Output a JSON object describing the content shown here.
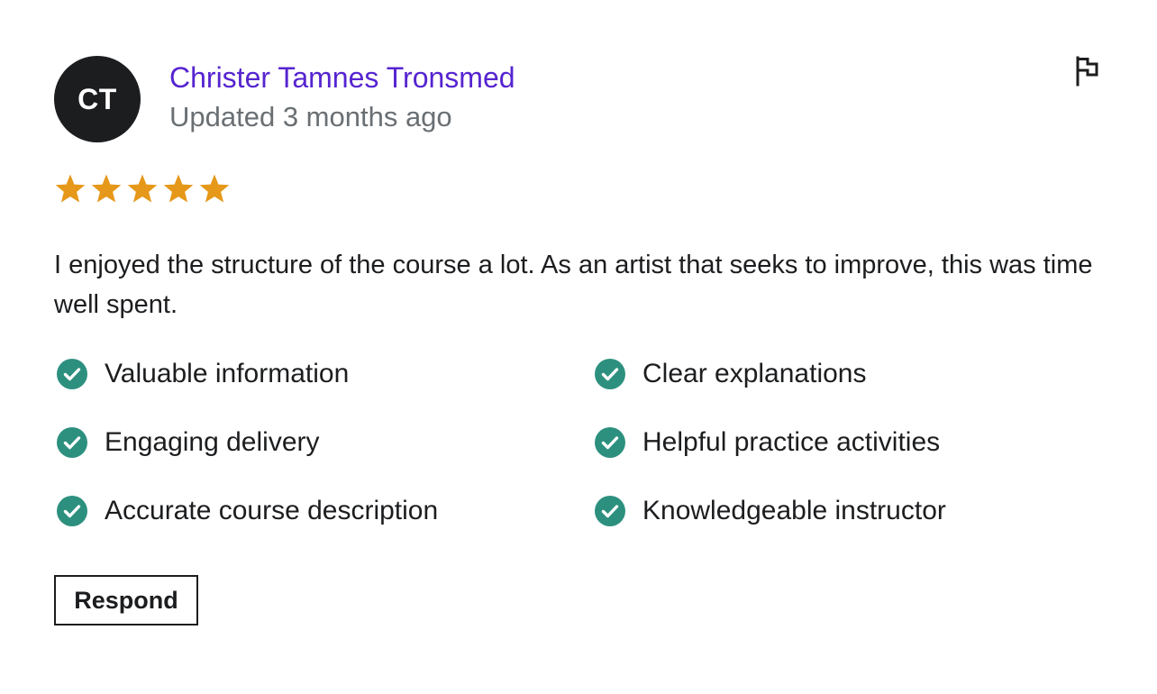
{
  "review": {
    "avatar_initials": "CT",
    "reviewer_name": "Christer Tamnes Tronsmed",
    "updated_text": "Updated 3 months ago",
    "rating": 5,
    "rating_max": 5,
    "text": "I enjoyed the structure of the course a lot. As an artist that seeks to improve, this was time well spent.",
    "flag_icon": "flag-icon",
    "star_icon": "star-icon",
    "check_icon": "check-circle-icon"
  },
  "feedback": {
    "items": [
      {
        "label": "Valuable information"
      },
      {
        "label": "Clear explanations"
      },
      {
        "label": "Engaging delivery"
      },
      {
        "label": "Helpful practice activities"
      },
      {
        "label": "Accurate course description"
      },
      {
        "label": "Knowledgeable instructor"
      }
    ]
  },
  "actions": {
    "respond_label": "Respond"
  },
  "colors": {
    "reviewer_name": "#5624d0",
    "star": "#e59819",
    "check": "#2d907f",
    "avatar_bg": "#1c1d1f",
    "text": "#1c1d1f",
    "muted": "#6a6f73"
  }
}
